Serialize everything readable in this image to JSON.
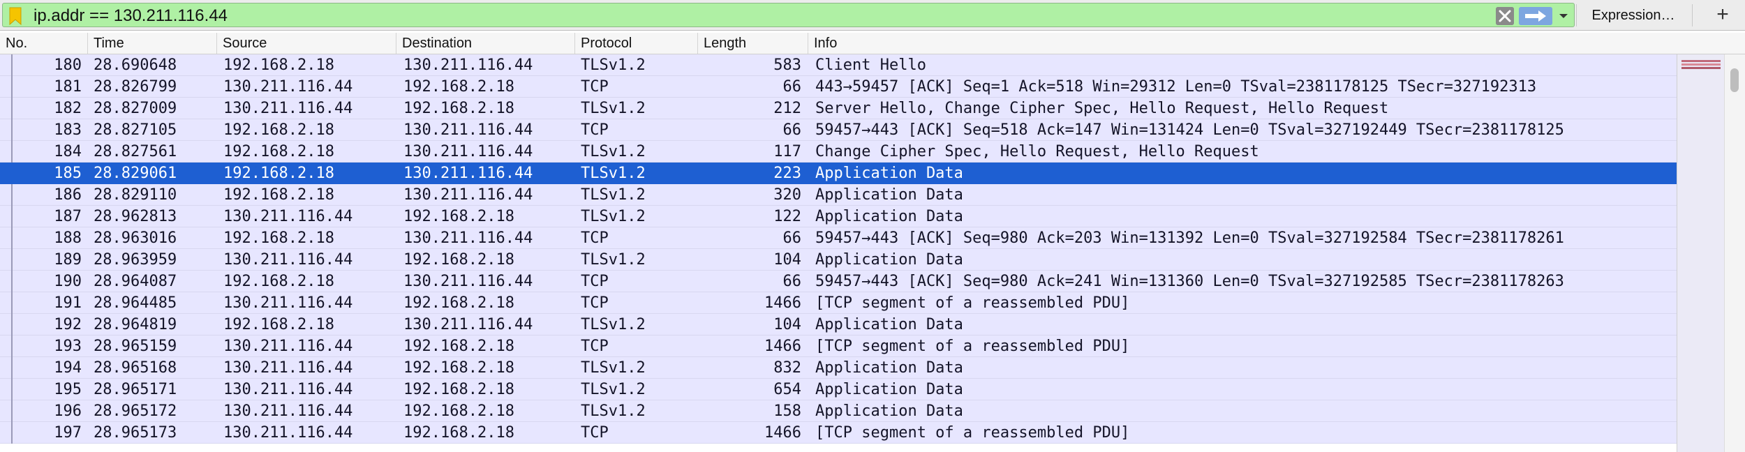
{
  "filter": {
    "text": "ip.addr == 130.211.116.44",
    "expression_label": "Expression…",
    "add_label": "+"
  },
  "icons": {
    "bookmark": "bookmark-icon",
    "clear": "clear-filter-icon",
    "apply": "apply-arrow-icon",
    "recent": "chevron-down-icon"
  },
  "colors": {
    "filter_valid": "#aff0a4",
    "row_bg": "#e7e6ff",
    "selected_bg": "#1e5fd2",
    "bookmark": "#f5c400"
  },
  "columns": {
    "no": "No.",
    "time": "Time",
    "source": "Source",
    "destination": "Destination",
    "protocol": "Protocol",
    "length": "Length",
    "info": "Info"
  },
  "packets": [
    {
      "no": "180",
      "time": "28.690648",
      "source": "192.168.2.18",
      "destination": "130.211.116.44",
      "protocol": "TLSv1.2",
      "length": "583",
      "info": "Client Hello"
    },
    {
      "no": "181",
      "time": "28.826799",
      "source": "130.211.116.44",
      "destination": "192.168.2.18",
      "protocol": "TCP",
      "length": "66",
      "info": "443→59457 [ACK] Seq=1 Ack=518 Win=29312 Len=0 TSval=2381178125 TSecr=327192313"
    },
    {
      "no": "182",
      "time": "28.827009",
      "source": "130.211.116.44",
      "destination": "192.168.2.18",
      "protocol": "TLSv1.2",
      "length": "212",
      "info": "Server Hello, Change Cipher Spec, Hello Request, Hello Request"
    },
    {
      "no": "183",
      "time": "28.827105",
      "source": "192.168.2.18",
      "destination": "130.211.116.44",
      "protocol": "TCP",
      "length": "66",
      "info": "59457→443 [ACK] Seq=518 Ack=147 Win=131424 Len=0 TSval=327192449 TSecr=2381178125"
    },
    {
      "no": "184",
      "time": "28.827561",
      "source": "192.168.2.18",
      "destination": "130.211.116.44",
      "protocol": "TLSv1.2",
      "length": "117",
      "info": "Change Cipher Spec, Hello Request, Hello Request"
    },
    {
      "no": "185",
      "time": "28.829061",
      "source": "192.168.2.18",
      "destination": "130.211.116.44",
      "protocol": "TLSv1.2",
      "length": "223",
      "info": "Application Data",
      "selected": true
    },
    {
      "no": "186",
      "time": "28.829110",
      "source": "192.168.2.18",
      "destination": "130.211.116.44",
      "protocol": "TLSv1.2",
      "length": "320",
      "info": "Application Data"
    },
    {
      "no": "187",
      "time": "28.962813",
      "source": "130.211.116.44",
      "destination": "192.168.2.18",
      "protocol": "TLSv1.2",
      "length": "122",
      "info": "Application Data"
    },
    {
      "no": "188",
      "time": "28.963016",
      "source": "192.168.2.18",
      "destination": "130.211.116.44",
      "protocol": "TCP",
      "length": "66",
      "info": "59457→443 [ACK] Seq=980 Ack=203 Win=131392 Len=0 TSval=327192584 TSecr=2381178261"
    },
    {
      "no": "189",
      "time": "28.963959",
      "source": "130.211.116.44",
      "destination": "192.168.2.18",
      "protocol": "TLSv1.2",
      "length": "104",
      "info": "Application Data"
    },
    {
      "no": "190",
      "time": "28.964087",
      "source": "192.168.2.18",
      "destination": "130.211.116.44",
      "protocol": "TCP",
      "length": "66",
      "info": "59457→443 [ACK] Seq=980 Ack=241 Win=131360 Len=0 TSval=327192585 TSecr=2381178263"
    },
    {
      "no": "191",
      "time": "28.964485",
      "source": "130.211.116.44",
      "destination": "192.168.2.18",
      "protocol": "TCP",
      "length": "1466",
      "info": "[TCP segment of a reassembled PDU]"
    },
    {
      "no": "192",
      "time": "28.964819",
      "source": "192.168.2.18",
      "destination": "130.211.116.44",
      "protocol": "TLSv1.2",
      "length": "104",
      "info": "Application Data"
    },
    {
      "no": "193",
      "time": "28.965159",
      "source": "130.211.116.44",
      "destination": "192.168.2.18",
      "protocol": "TCP",
      "length": "1466",
      "info": "[TCP segment of a reassembled PDU]"
    },
    {
      "no": "194",
      "time": "28.965168",
      "source": "130.211.116.44",
      "destination": "192.168.2.18",
      "protocol": "TLSv1.2",
      "length": "832",
      "info": "Application Data"
    },
    {
      "no": "195",
      "time": "28.965171",
      "source": "130.211.116.44",
      "destination": "192.168.2.18",
      "protocol": "TLSv1.2",
      "length": "654",
      "info": "Application Data"
    },
    {
      "no": "196",
      "time": "28.965172",
      "source": "130.211.116.44",
      "destination": "192.168.2.18",
      "protocol": "TLSv1.2",
      "length": "158",
      "info": "Application Data"
    },
    {
      "no": "197",
      "time": "28.965173",
      "source": "130.211.116.44",
      "destination": "192.168.2.18",
      "protocol": "TCP",
      "length": "1466",
      "info": "[TCP segment of a reassembled PDU]"
    }
  ]
}
